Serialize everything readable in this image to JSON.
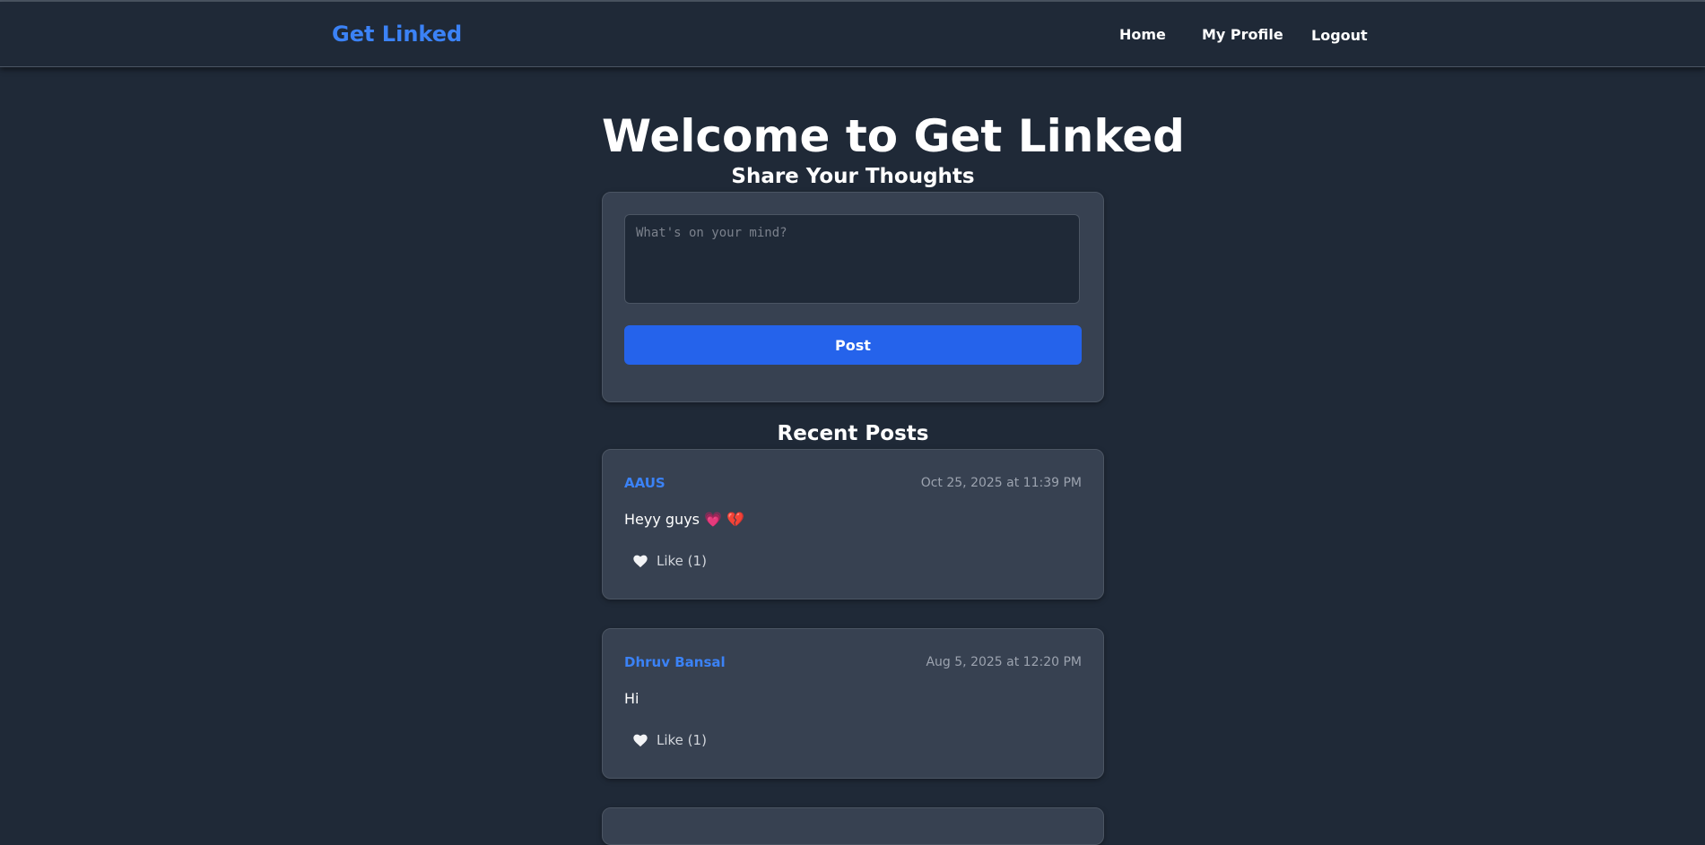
{
  "nav": {
    "brand": "Get Linked",
    "links": [
      "Home",
      "My Profile",
      "Logout"
    ]
  },
  "main": {
    "title": "Welcome to Get Linked",
    "share_heading": "Share Your Thoughts",
    "composer": {
      "placeholder": "What's on your mind?",
      "post_label": "Post"
    },
    "recent_heading": "Recent Posts",
    "posts": [
      {
        "author": "AAUS",
        "time": "Oct 25, 2025 at 11:39 PM",
        "content": "Heyy guys 💗 💔",
        "like_label": "Like (1)"
      },
      {
        "author": "Dhruv Bansal",
        "time": "Aug 5, 2025 at 12:20 PM",
        "content": "Hi",
        "like_label": "Like (1)"
      }
    ]
  },
  "colors": {
    "background": "#1f2937",
    "card": "#374151",
    "accent": "#3b82f6",
    "button": "#2563eb"
  }
}
